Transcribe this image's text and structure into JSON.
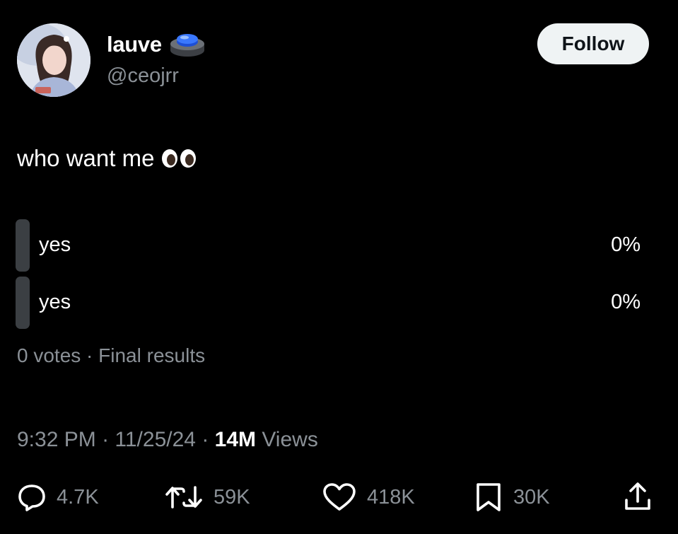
{
  "user": {
    "display_name": "lauve",
    "handle": "@ceojrr",
    "follow_label": "Follow"
  },
  "tweet": {
    "text": "who want me",
    "emoji": "eyes-emoji"
  },
  "poll": {
    "options": [
      {
        "label": "yes",
        "percent": "0%"
      },
      {
        "label": "yes",
        "percent": "0%"
      }
    ],
    "meta": "0 votes · Final results"
  },
  "timestamp": {
    "time": "9:32 PM",
    "date": "11/25/24",
    "views_count": "14M",
    "views_label": "Views"
  },
  "actions": {
    "replies": "4.7K",
    "reposts": "59K",
    "likes": "418K",
    "bookmarks": "30K"
  },
  "colors": {
    "background": "#000000",
    "muted_text": "#8b9197",
    "poll_bar": "#3b3f43",
    "follow_button": "#eff3f4"
  }
}
